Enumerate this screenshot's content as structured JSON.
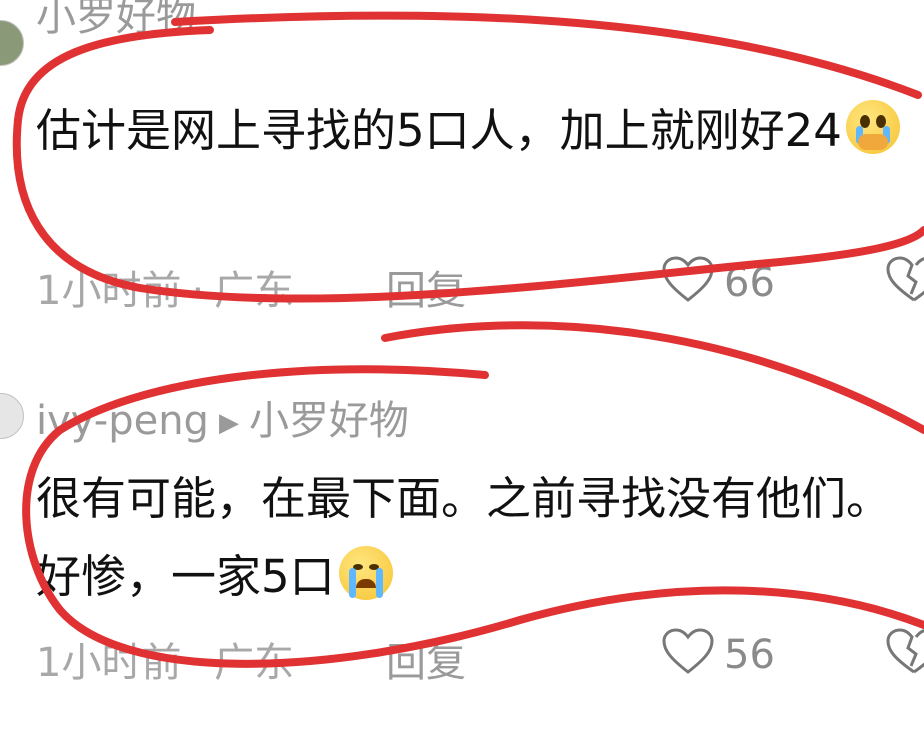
{
  "comments": [
    {
      "username": "小罗好物",
      "text": "估计是网上寻找的5口人，加上就刚好24",
      "emoji": "face-holding-back-tears-emoji",
      "time": "1小时前",
      "location": "广东",
      "reply_label": "回复",
      "likes": "66"
    },
    {
      "username": "ivy-peng",
      "reply_to": "小罗好物",
      "text": "很有可能，在最下面。之前寻找没有他们。好惨，一家5口",
      "emoji": "loudly-crying-face-emoji",
      "time": "1小时前",
      "location": "广东",
      "reply_label": "回复",
      "likes": "56"
    }
  ],
  "separator": "·",
  "annotation_color": "#e03232"
}
